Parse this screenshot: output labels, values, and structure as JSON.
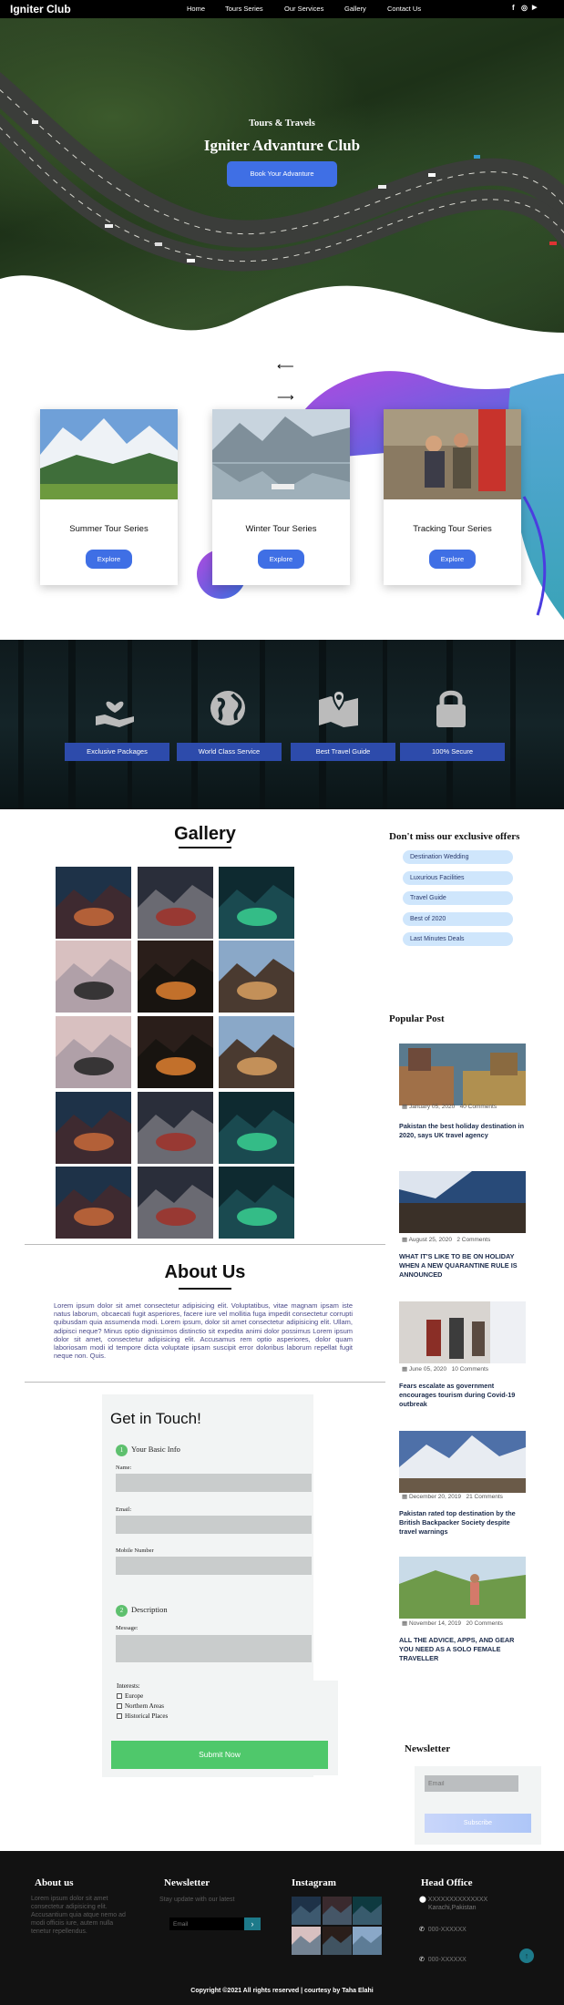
{
  "nav": {
    "brand": "Igniter Club",
    "links": [
      "Home",
      "Tours Series",
      "Our Services",
      "Gallery",
      "Contact Us"
    ],
    "social": [
      "f",
      "◎",
      "▶"
    ]
  },
  "hero": {
    "subtitle": "Tours & Travels",
    "title": "Igniter Advanture Club",
    "button": "Book Your Advanture"
  },
  "tours": {
    "prev_arrow": "⟵",
    "next_arrow": "⟶",
    "cards": [
      {
        "title": "Summer Tour Series",
        "button": "Explore"
      },
      {
        "title": "Winter Tour Series",
        "button": "Explore"
      },
      {
        "title": "Tracking Tour Series",
        "button": "Explore"
      }
    ]
  },
  "features": [
    {
      "label": "Exclusive Packages",
      "icon": "hand-heart-icon"
    },
    {
      "label": "World Class Service",
      "icon": "globe-icon"
    },
    {
      "label": "Best Travel Guide",
      "icon": "map-icon"
    },
    {
      "label": "100% Secure",
      "icon": "lock-icon"
    }
  ],
  "gallery": {
    "title": "Gallery"
  },
  "about": {
    "title": "About Us",
    "text": "Lorem ipsum dolor sit amet consectetur adipisicing elit. Voluptatibus, vitae magnam ipsam iste natus laborum, obcaecati fugit asperiores, facere iure vel mollitia fuga impedit consectetur corrupti quibusdam quia assumenda modi. Lorem ipsum, dolor sit amet consectetur adipisicing elit. Ullam, adipisci neque? Minus optio dignissimos distinctio sit expedita animi dolor possimus Lorem ipsum dolor sit amet, consectetur adipisicing elit. Accusamus rem optio asperiores, dolor quam laboriosam modi id tempore dicta voluptate ipsam suscipit error doloribus laborum repellat fugit neque non. Quis."
  },
  "contact": {
    "title": "Get in Touch!",
    "step1_num": "1",
    "step1": "Your Basic Info",
    "name_label": "Name:",
    "email_label": "Email:",
    "mobile_label": "Mobile Number",
    "step2_num": "2",
    "step2": "Description",
    "message_label": "Message:",
    "interests_label": "Interests:",
    "interests": [
      "Europe",
      "Northern Areas",
      "Historical Places"
    ],
    "submit": "Submit Now"
  },
  "sidebar": {
    "offers_title": "Don't miss our exclusive offers",
    "offers": [
      "Destination Wedding",
      "Luxurious Facilities",
      "Travel Guide",
      "Best of 2020",
      "Last Minutes Deals"
    ],
    "popular_title": "Popular Post",
    "posts": [
      {
        "date": "January 05, 2020",
        "comments": "40 Comments",
        "title": "Pakistan the best holiday destination in 2020, says UK travel agency"
      },
      {
        "date": "August 25, 2020",
        "comments": "2 Comments",
        "title": "WHAT IT'S LIKE TO BE ON HOLIDAY WHEN A NEW QUARANTINE RULE IS ANNOUNCED"
      },
      {
        "date": "June 05, 2020",
        "comments": "10 Comments",
        "title": "Fears escalate as government encourages tourism during Covid-19 outbreak"
      },
      {
        "date": "December 20, 2019",
        "comments": "21 Comments",
        "title": "Pakistan rated top destination by the British Backpacker Society despite travel warnings"
      },
      {
        "date": "November 14, 2019",
        "comments": "20 Comments",
        "title": "ALL THE ADVICE, APPS, AND GEAR YOU NEED AS A SOLO FEMALE TRAVELLER"
      }
    ],
    "newsletter_title": "Newsletter",
    "newsletter_placeholder": "Email",
    "newsletter_button": "Subscribe"
  },
  "footer": {
    "about_title": "About us",
    "about_text": "Lorem ipsum dolor sit amet consectetur adipisicing elit. Accusantium quia atque nemo ad modi officiis iure, autem nulla tenetur repellendus.",
    "newsletter_title": "Newsletter",
    "newsletter_text": "Stay update with our latest",
    "newsletter_placeholder": "Email",
    "newsletter_go": "›",
    "instagram_title": "Instagram",
    "office_title": "Head Office",
    "address": "XXXXXXXXXXXXXX",
    "address2": "Karachi,Pakistan",
    "phone1": "000-XXXXXX",
    "phone2": "000-XXXXXX",
    "top_button": "↑",
    "copyright": "Copyright ©2021 All rights reserved | courtesy by Taha Elahi"
  }
}
